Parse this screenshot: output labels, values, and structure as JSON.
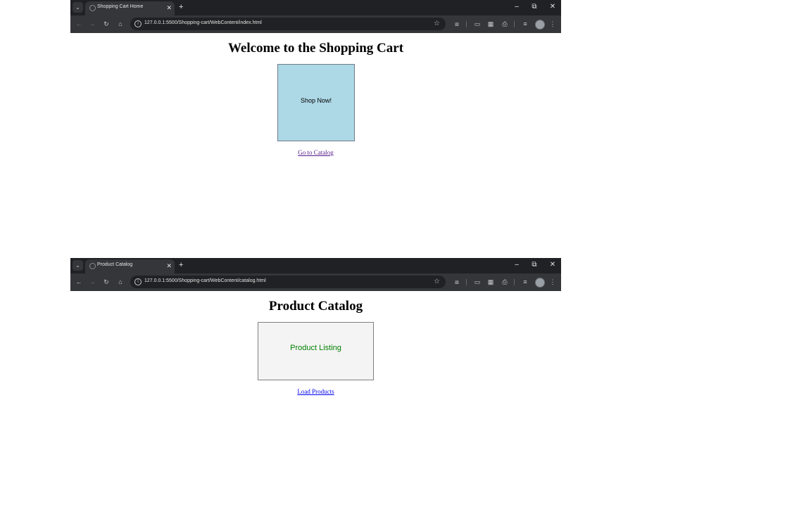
{
  "windows": [
    {
      "tab": {
        "title": "Shopping Cart Home",
        "close": "✕"
      },
      "new_tab": "+",
      "controls": {
        "minimize": "–",
        "restore": "⧉",
        "close": "✕"
      },
      "address": {
        "url": "127.0.0.1:5500/Shopping-cart/WebContent/index.html"
      },
      "page": {
        "heading": "Welcome to the Shopping Cart",
        "box_text": "Shop Now!",
        "box_color": "#add8e6",
        "link_text": "Go to Catalog",
        "link_color": "#551a8b"
      }
    },
    {
      "tab": {
        "title": "Product Catalog",
        "close": "✕"
      },
      "new_tab": "+",
      "controls": {
        "minimize": "–",
        "restore": "⧉",
        "close": "✕"
      },
      "address": {
        "url": "127.0.0.1:5500/Shopping-cart/WebContent/catalog.html"
      },
      "page": {
        "heading": "Product Catalog",
        "box_text": "Product Listing",
        "box_color": "#f4f4f4",
        "box_text_color": "#008000",
        "link_text": "Load Products",
        "link_color": "#0000ee"
      }
    }
  ],
  "icons": {
    "tab_search": "chevron-down-icon",
    "back": "back-arrow-icon",
    "forward": "forward-arrow-icon",
    "reload": "reload-icon",
    "home": "home-icon",
    "site_info": "site-info-icon",
    "bookmark": "star-icon",
    "extensions": "puzzle-icon",
    "media": "media-icon",
    "apps": "apps-icon",
    "print": "print-icon",
    "reading_list": "reading-list-icon",
    "profile": "avatar",
    "menu": "kebab-menu-icon"
  }
}
